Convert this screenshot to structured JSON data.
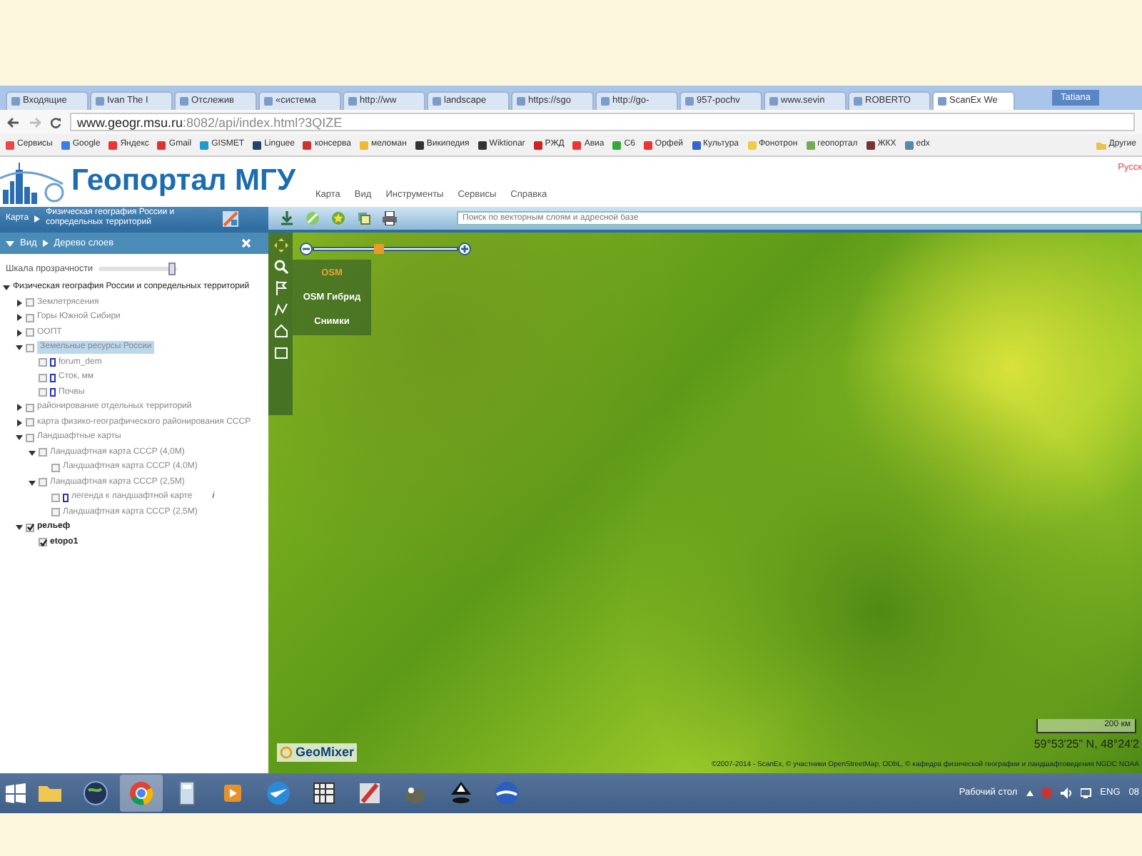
{
  "browser": {
    "tabs": [
      {
        "label": "Входящие",
        "selected": false
      },
      {
        "label": "Ivan The I",
        "selected": false
      },
      {
        "label": "Отслежив",
        "selected": false
      },
      {
        "label": "«система",
        "selected": false
      },
      {
        "label": "http://ww",
        "selected": false
      },
      {
        "label": "landscape",
        "selected": false
      },
      {
        "label": "https://sgo",
        "selected": false
      },
      {
        "label": "http://go-",
        "selected": false
      },
      {
        "label": "957-pochv",
        "selected": false
      },
      {
        "label": "www.sevin",
        "selected": false
      },
      {
        "label": "ROBERTO",
        "selected": false
      },
      {
        "label": "ScanEx We",
        "selected": true
      }
    ],
    "user": "Tatiana",
    "address": {
      "host": "www.geogr.msu.ru",
      "path": ":8082/api/index.html?3QIZE"
    },
    "bookmarks": [
      "Сервисы",
      "Google",
      "Яндекс",
      "Gmail",
      "GISMET",
      "Linguee",
      "консерва",
      "меломан",
      "Википедия",
      "Wiktionar",
      "РЖД",
      "Авиа",
      "C6",
      "Орфей",
      "Культура",
      "Фонотрон",
      "геопортал",
      "ЖКХ",
      "edx"
    ],
    "other_bookmarks": "Другие"
  },
  "site": {
    "logo": "Геопортал МГУ",
    "menu": [
      "Карта",
      "Вид",
      "Инструменты",
      "Сервисы",
      "Справка"
    ],
    "language": "Русск"
  },
  "map_bar": {
    "crumb": "Карта",
    "title": "Физическая география России и сопредельных территорий",
    "search": {
      "placeholder": "Поиск по векторным слоям и адресной базе"
    }
  },
  "panel": {
    "crumb": "Вид",
    "title": "Дерево слоев",
    "transparency": {
      "label": "Шкала прозрачности",
      "level": 0.95
    },
    "tree": [
      {
        "label": "Физическая география России и сопредельных территорий",
        "kind": "root",
        "expanded": true,
        "children": [
          {
            "label": "Землетрясения",
            "kind": "group",
            "checked": false,
            "expanded": false,
            "selected": false
          },
          {
            "label": "Горы Южной Сибири",
            "kind": "group",
            "checked": false,
            "expanded": false,
            "selected": false
          },
          {
            "label": "ООПТ",
            "kind": "group",
            "checked": false,
            "expanded": false,
            "selected": false
          },
          {
            "label": "Земельные ресурсы России",
            "kind": "group",
            "checked": false,
            "expanded": true,
            "selected": true,
            "children": [
              {
                "label": "forum_dem",
                "kind": "vector",
                "checked": false,
                "selected": false
              },
              {
                "label": "Сток, мм",
                "kind": "vector",
                "checked": false,
                "selected": false
              },
              {
                "label": "Почвы",
                "kind": "vector",
                "checked": false,
                "selected": false
              }
            ]
          },
          {
            "label": "районирование отдельных территорий",
            "kind": "group",
            "checked": false,
            "expanded": false,
            "selected": false
          },
          {
            "label": "карта физико-географического районирования СССР",
            "kind": "group",
            "checked": false,
            "expanded": false,
            "selected": false
          },
          {
            "label": "Ландшафтные карты",
            "kind": "group",
            "checked": false,
            "expanded": true,
            "selected": false,
            "children": [
              {
                "label": "Ландшафтная карта СССР (4,0М)",
                "kind": "group",
                "checked": false,
                "expanded": true,
                "selected": false,
                "children": [
                  {
                    "label": "Ландшафтная карта СССР (4,0М)",
                    "kind": "raster",
                    "checked": false,
                    "selected": false
                  }
                ]
              },
              {
                "label": "Ландшафтная карта СССР (2,5М)",
                "kind": "group",
                "checked": false,
                "expanded": true,
                "selected": false,
                "children": [
                  {
                    "label": "легенда к ландшафтной карте",
                    "kind": "vector",
                    "checked": false,
                    "selected": false,
                    "info": "i"
                  },
                  {
                    "label": "Ландшафтная карта СССР (2,5М)",
                    "kind": "raster",
                    "checked": false,
                    "selected": false
                  }
                ]
              }
            ]
          },
          {
            "label": "рельеф",
            "kind": "group",
            "checked": true,
            "expanded": true,
            "selected": false,
            "children": [
              {
                "label": "etopo1",
                "kind": "raster",
                "checked": true,
                "selected": false
              }
            ]
          }
        ]
      }
    ]
  },
  "map": {
    "zoom": {
      "level": 0.45
    },
    "basemaps": [
      {
        "label": "OSM",
        "selected": true
      },
      {
        "label": "OSM Гибрид",
        "selected": false
      },
      {
        "label": "Снимки",
        "selected": false
      }
    ],
    "logo": "GeoMixer",
    "scale": "200 км",
    "coordinates": "59°53'25\" N, 48°24'2",
    "attribution": "©2007-2014 - ScanEx, © участники OpenStreetMap, ODbL, © кафедра физической географии и ландшафтоведения NGDC NOAA"
  },
  "taskbar": {
    "apps": [
      {
        "kind": "folder",
        "selected": false
      },
      {
        "kind": "globe",
        "selected": false
      },
      {
        "kind": "chrome",
        "selected": true
      },
      {
        "kind": "calculator",
        "selected": false
      },
      {
        "kind": "player",
        "selected": false
      },
      {
        "kind": "plane",
        "selected": false
      },
      {
        "kind": "pattern",
        "selected": false
      },
      {
        "kind": "pen",
        "selected": false
      },
      {
        "kind": "gimp",
        "selected": false
      },
      {
        "kind": "inkscape",
        "selected": false
      },
      {
        "kind": "earth",
        "selected": false
      }
    ],
    "desktop": "Рабочий стол",
    "language": "ENG",
    "clock": "08"
  }
}
